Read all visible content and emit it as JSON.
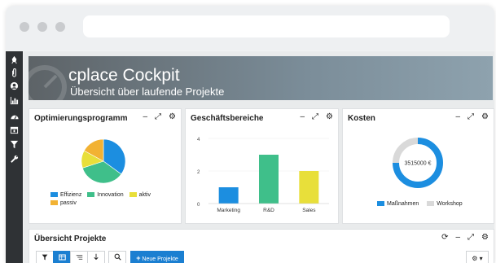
{
  "banner": {
    "title": "cplace Cockpit",
    "subtitle": "Übersicht über laufende Projekte"
  },
  "sidebar": {
    "icons": [
      "rocket-icon",
      "paperclip-icon",
      "user-circle-icon",
      "bar-chart-icon",
      "dashboard-icon",
      "calendar-icon",
      "filter-icon",
      "wrench-icon"
    ]
  },
  "panels": {
    "optimierung": {
      "title": "Optimierungsprogramm",
      "controls": [
        "–",
        "⤢",
        "⚙"
      ]
    },
    "geschaeft": {
      "title": "Geschäftsbereiche",
      "controls": [
        "–",
        "⤢",
        "⚙"
      ]
    },
    "kosten": {
      "title": "Kosten",
      "controls": [
        "–",
        "⤢",
        "⚙"
      ],
      "center_label": "3515000 €"
    },
    "uebersicht": {
      "title": "Übersicht Projekte",
      "controls": [
        "⟳",
        "–",
        "⤢",
        "⚙"
      ],
      "new_button": "Neue Projekte",
      "settings_btn": "⚙ ▾"
    }
  },
  "colors": {
    "blue": "#1c8ee0",
    "green": "#3fbf8a",
    "yellow": "#e8df3a",
    "orange": "#f2b233",
    "gray": "#d9d9d9",
    "button_blue": "#1b7fd1"
  },
  "chart_data": [
    {
      "type": "pie",
      "labels": [
        "Effizienz",
        "Innovation",
        "aktiv",
        "passiv"
      ],
      "values": [
        35,
        35,
        13,
        17
      ],
      "legend": [
        "Effizienz",
        "Innovation",
        "aktiv",
        "passiv"
      ],
      "colors": [
        "#1c8ee0",
        "#3fbf8a",
        "#e8df3a",
        "#f2b233"
      ]
    },
    {
      "type": "bar",
      "categories": [
        "Marketing",
        "R&D",
        "Sales"
      ],
      "values": [
        1,
        3,
        2
      ],
      "ylim": [
        0,
        4
      ],
      "yticks": [
        "0",
        "2",
        "4"
      ],
      "colors": [
        "#1c8ee0",
        "#3fbf8a",
        "#e8df3a"
      ]
    },
    {
      "type": "pie",
      "labels": [
        "Maßnahmen",
        "Workshop"
      ],
      "values": [
        75,
        25
      ],
      "legend": [
        "Maßnahmen",
        "Workshop"
      ],
      "colors": [
        "#1c8ee0",
        "#d9d9d9"
      ],
      "center_label": "3515000 €"
    }
  ]
}
